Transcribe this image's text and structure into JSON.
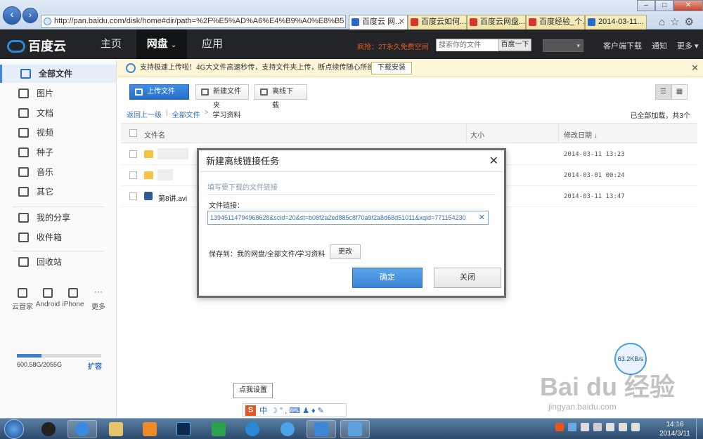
{
  "browser": {
    "url": "http://pan.baidu.com/disk/home#dir/path=%2F%E5%AD%A6%E4%B9%A0%E8%B5",
    "tabs": [
      {
        "label": "百度云 网...",
        "active": true
      },
      {
        "label": "百度云如何...",
        "active": false
      },
      {
        "label": "百度云网盘...",
        "active": false
      },
      {
        "label": "百度经验_个...",
        "active": false
      },
      {
        "label": "2014-03-11...",
        "active": false
      }
    ],
    "win_min": "–",
    "win_max": "□",
    "win_close": "✕",
    "right_icons": "⌂☆⚙"
  },
  "header": {
    "logo": "百度云",
    "nav": [
      "主页",
      "网盘",
      "应用"
    ],
    "nav_arrow": "⌄",
    "promo": "疯抢：2T永久免费空间",
    "search_placeholder": "搜索你的文件",
    "search_button": "百度一下",
    "user_arrow": "▾",
    "links": [
      "客户端下载",
      "通知",
      "更多"
    ]
  },
  "sidebar": {
    "items": [
      "全部文件",
      "图片",
      "文档",
      "视频",
      "种子",
      "音乐",
      "其它"
    ],
    "share_items": [
      "我的分享",
      "收件箱"
    ],
    "trash": "回收站",
    "devices": [
      "云管家",
      "Android",
      "iPhone",
      "更多"
    ],
    "quota_used": 600.58,
    "quota_total": 2055,
    "quota_text": "600.58G/2055G",
    "expand": "扩容"
  },
  "notice": {
    "text": "支持极速上传啦！4G大文件高速秒传，支持文件夹上传，断点续传随心所欲！",
    "button": "下载安装",
    "close": "✕"
  },
  "toolbar": {
    "upload": "上传文件",
    "new_folder": "新建文件夹",
    "offline": "离线下载",
    "list_view": "☰",
    "grid_view": "▦"
  },
  "breadcrumb": {
    "back": "返回上一级",
    "sep1": "|",
    "all": "全部文件",
    "sep2": ">",
    "current": "学习资料",
    "loaded": "已全部加载，共3个"
  },
  "table": {
    "col_name": "文件名",
    "col_size": "大小",
    "col_date": "修改日期",
    "sort_arrow": "↓",
    "rows": [
      {
        "name": "",
        "date": "2014-03-11 13:23",
        "type": "folder"
      },
      {
        "name": "",
        "date": "2014-03-01 00:24",
        "type": "folder"
      },
      {
        "name": "第8讲.avi",
        "date": "2014-03-11 13:47",
        "type": "video"
      }
    ]
  },
  "modal": {
    "title": "新建离线链接任务",
    "close": "✕",
    "hint": "填写要下载的文件链接",
    "link_label": "文件链接：",
    "link_value": "13945114794968628&scid=20&st=b08f2a2ed885c8f70a9f2a8d68d51011&xqid=771154230",
    "link_clear": "✕",
    "save_to": "保存到：我的网盘/全部文件/学习资料",
    "change": "更改",
    "ok": "确定",
    "cancel": "关闭"
  },
  "float": {
    "speed": "63.2KB/s",
    "tooltip": "点我设置",
    "ime_logo": "S",
    "ime_mode": "中",
    "ime_icons": "☽°,⌨♟♦✎"
  },
  "watermark": {
    "text": "Bai du 经验",
    "url": "jingyan.baidu.com"
  },
  "taskbar": {
    "time": "14:16",
    "date": "2014/3/11"
  },
  "colors": {
    "accent": "#3c86d8",
    "header_bg": "#222427",
    "promo": "#e25d20"
  }
}
